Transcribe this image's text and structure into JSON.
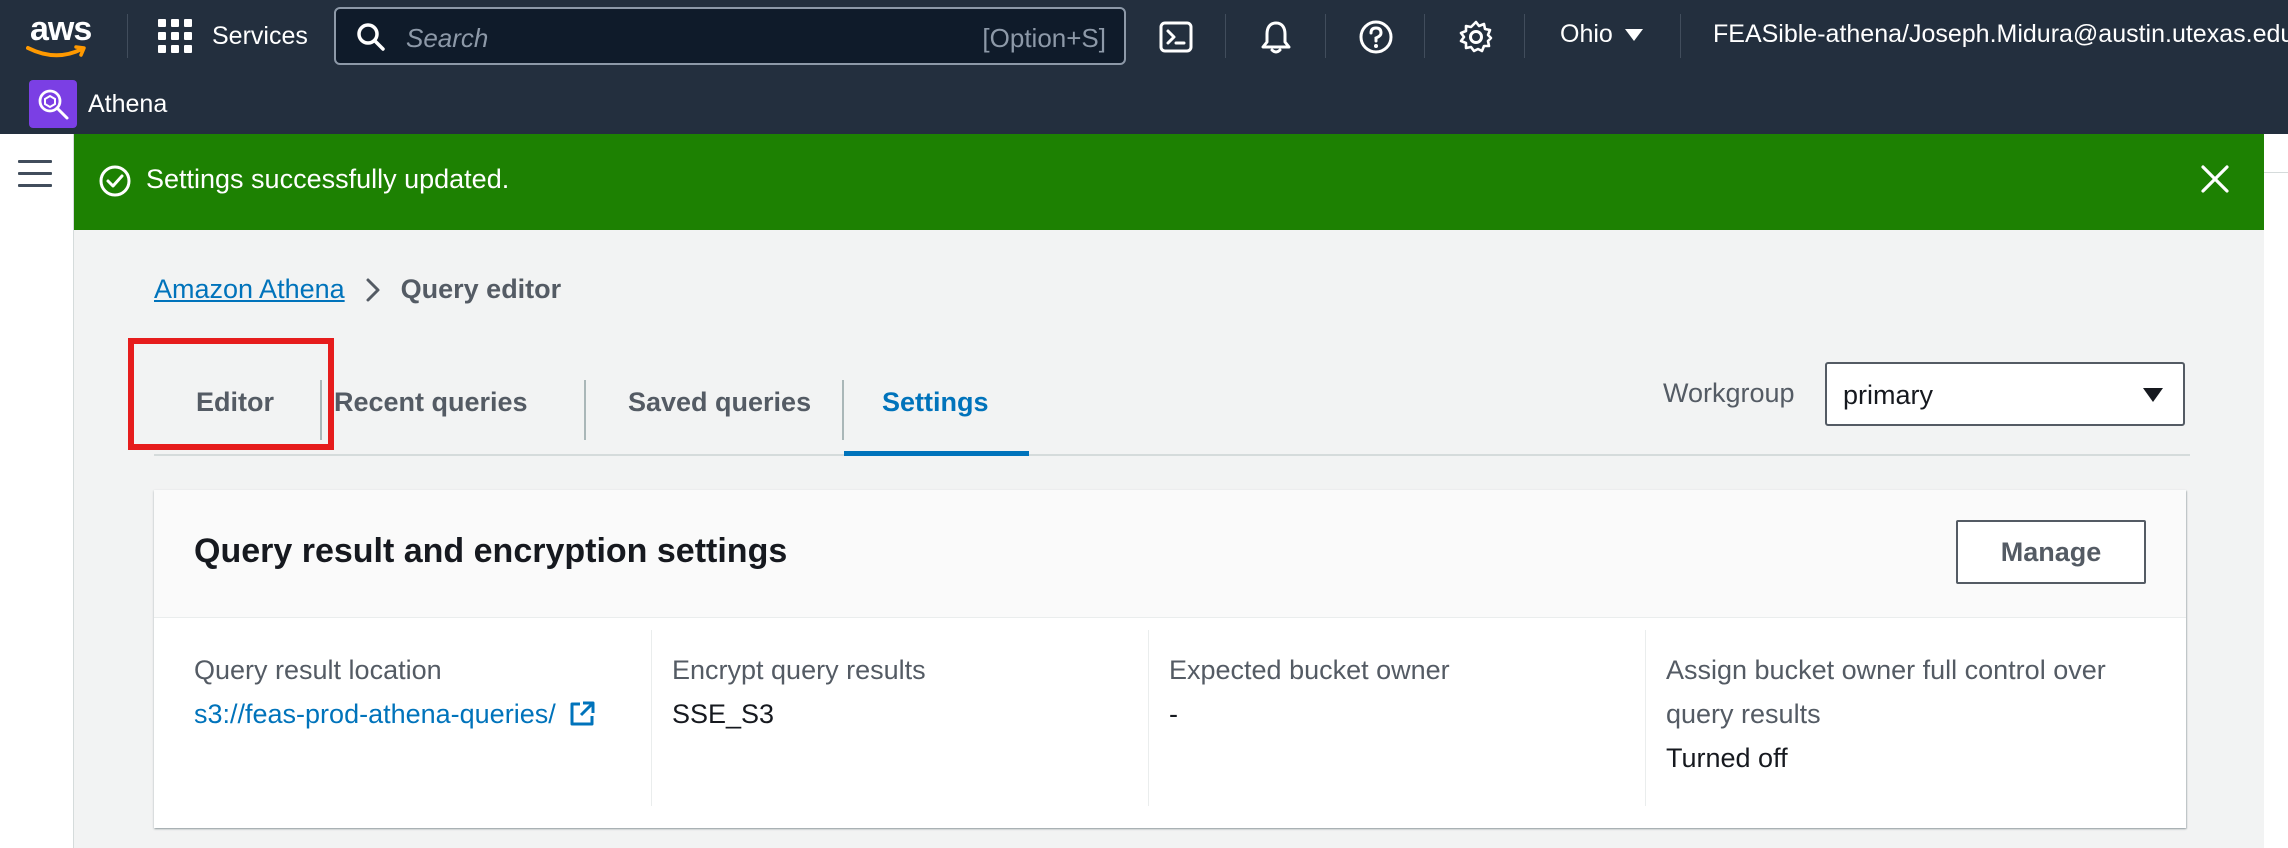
{
  "topnav": {
    "logo_text": "aws",
    "services_label": "Services",
    "search_placeholder": "Search",
    "search_shortcut": "[Option+S]",
    "region": "Ohio",
    "account": "FEASible-athena/Joseph.Midura@austin.utexas.edu",
    "icons": [
      "cloudshell-icon",
      "bell-icon",
      "help-icon",
      "settings-icon"
    ]
  },
  "service_bar": {
    "service_name": "Athena",
    "service_color": "#7b3fe4"
  },
  "flash": {
    "message": "Settings successfully updated.",
    "color": "#1d8102"
  },
  "breadcrumb": {
    "root": "Amazon Athena",
    "current": "Query editor"
  },
  "tabs": [
    {
      "label": "Editor",
      "active": false
    },
    {
      "label": "Recent queries",
      "active": false
    },
    {
      "label": "Saved queries",
      "active": false
    },
    {
      "label": "Settings",
      "active": true
    }
  ],
  "workgroup": {
    "label": "Workgroup",
    "value": "primary"
  },
  "settings_card": {
    "title": "Query result and encryption settings",
    "manage_label": "Manage",
    "fields": [
      {
        "label": "Query result location",
        "value": "s3://feas-prod-athena-queries/"
      },
      {
        "label": "Encrypt query results",
        "value": "SSE_S3"
      },
      {
        "label": "Expected bucket owner",
        "value": "-"
      },
      {
        "label": "Assign bucket owner full control over query results",
        "value": "Turned off"
      }
    ]
  },
  "colors": {
    "nav_bg": "#232f3e",
    "link": "#0073bb",
    "highlight": "#e61c1c"
  }
}
